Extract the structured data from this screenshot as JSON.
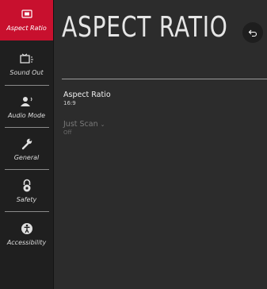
{
  "sidebar": {
    "items": [
      {
        "label": "Aspect Ratio",
        "icon": "aspect-ratio-icon",
        "active": true
      },
      {
        "label": "Sound Out",
        "icon": "sound-out-icon",
        "active": false
      },
      {
        "label": "Audio Mode",
        "icon": "audio-mode-icon",
        "active": false
      },
      {
        "label": "General",
        "icon": "wrench-icon",
        "active": false
      },
      {
        "label": "Safety",
        "icon": "lock-icon",
        "active": false
      },
      {
        "label": "Accessibility",
        "icon": "accessibility-icon",
        "active": false
      }
    ]
  },
  "main": {
    "title": "ASPECT RATIO",
    "back_icon": "back-icon",
    "settings": [
      {
        "name": "Aspect Ratio",
        "value": "16:9",
        "enabled": true
      },
      {
        "name": "Just Scan",
        "value": "Off",
        "enabled": false,
        "has_dropdown": true
      }
    ]
  },
  "colors": {
    "accent": "#c8102e",
    "sidebar_bg": "#1f1f1f",
    "main_bg": "#2c2c2c"
  }
}
